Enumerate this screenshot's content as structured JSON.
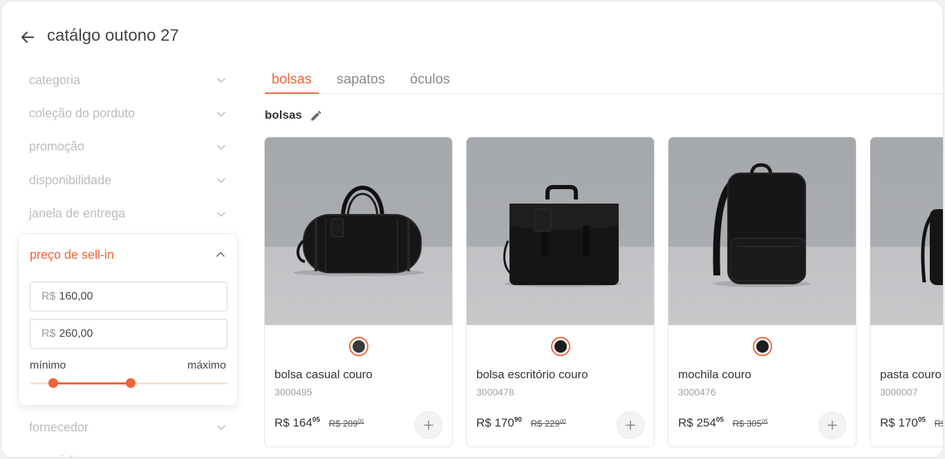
{
  "header": {
    "title": "catálgo outono 27"
  },
  "filters": {
    "top": [
      {
        "label": "categoria"
      },
      {
        "label": "coleção do porduto"
      },
      {
        "label": "promoção"
      },
      {
        "label": "disponibilidade"
      },
      {
        "label": "janela de entrega"
      }
    ],
    "price": {
      "label": "preço de sell-in",
      "currency": "R$",
      "min_value": "160,00",
      "max_value": "260,00",
      "min_label": "mínimo",
      "max_label": "máximo",
      "range_low_fraction": 0.12,
      "range_high_fraction": 0.51
    },
    "bottom": [
      {
        "label": "fornecedor"
      },
      {
        "label": "material"
      }
    ]
  },
  "tabs": [
    {
      "label": "bolsas",
      "active": true
    },
    {
      "label": "sapatos",
      "active": false
    },
    {
      "label": "óculos",
      "active": false
    }
  ],
  "section": {
    "title": "bolsas"
  },
  "colors": {
    "accent": "#f0643a"
  },
  "icons": {
    "back": "arrow-left-icon",
    "edit": "pencil-icon",
    "add": "plus-icon",
    "chevron": "chevron-down-icon"
  },
  "products": [
    {
      "name": "bolsa casual couro",
      "code": "3000495",
      "currency": "R$",
      "price_int": "164",
      "price_cents": "05",
      "old_price_int": "209",
      "old_price_cents": "05",
      "swatch": "#3a3a3a",
      "image": "duffel-bag"
    },
    {
      "name": "bolsa escritório couro",
      "code": "3000478",
      "currency": "R$",
      "price_int": "170",
      "price_cents": "90",
      "old_price_int": "229",
      "old_price_cents": "00",
      "swatch": "#1d1d1d",
      "image": "briefcase"
    },
    {
      "name": "mochila couro",
      "code": "3000476",
      "currency": "R$",
      "price_int": "254",
      "price_cents": "05",
      "old_price_int": "305",
      "old_price_cents": "05",
      "swatch": "#1d1d1d",
      "image": "backpack"
    },
    {
      "name": "pasta couro",
      "code": "3000007",
      "currency": "R$",
      "price_int": "170",
      "price_cents": "05",
      "old_price_int": "",
      "old_price_cents": "",
      "swatch": "#1d1d1d",
      "image": "folder-bag"
    }
  ]
}
